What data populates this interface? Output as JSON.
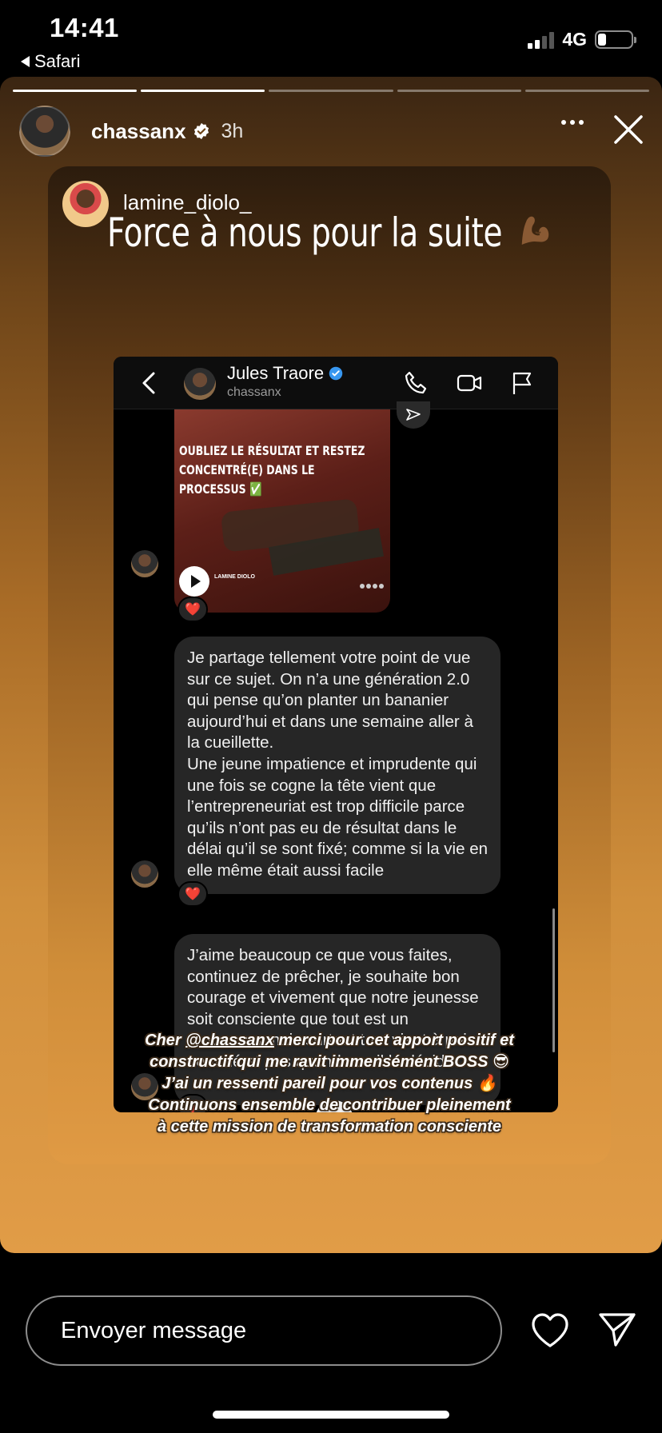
{
  "status_bar": {
    "time": "14:41",
    "back_app": "Safari",
    "network": "4G"
  },
  "story": {
    "progress_total": 5,
    "progress_done": 2,
    "username": "chassanx",
    "verified": true,
    "time_ago": "3h"
  },
  "repost": {
    "username": "lamine_diolo_",
    "title": "Force à nous pour la suite",
    "title_emoji": "flexed-biceps-icon"
  },
  "dm": {
    "contact_name": "Jules Traore",
    "contact_handle": "chassanx",
    "thumbnail_text": "Oubliez le résultat et restez concentré(e) dans le processus",
    "thumbnail_check": "✅",
    "thumbnail_brand": "LAMINE DIOLO",
    "message_1": "Je partage tellement votre point de vue sur ce sujet. On n’a une génération 2.0 qui pense qu’on planter un bananier aujourd’hui et dans une semaine aller à la cueillette.\nUne jeune impatience et imprudente qui une fois se cogne la tête vient que l’entrepreneuriat est trop difficile parce qu’ils n’ont pas eu de résultat dans le délai qu’il se sont fixé; comme si la vie en elle même était aussi facile",
    "message_2": "J’aime beaucoup ce que vous faites, continuez de prêcher, je souhaite bon courage et vivement que notre jeunesse soit consciente que tout est un processus mais surtout tout vient à point nommé et pas quand eux il le décide",
    "reaction": "❤️"
  },
  "caption": {
    "pre": "Cher ",
    "mention": "@chassanx",
    "line1_rest": " merci pour cet apport positif et",
    "line2": "constructif qui me ravit immensément BOSS 😎",
    "line3": "J’ai un ressenti pareil pour vos contenus 🔥",
    "line4": "Continuons ensemble de contribuer pleinement",
    "line5": "à cette mission de transformation consciente"
  },
  "reply": {
    "placeholder": "Envoyer message"
  },
  "colors": {
    "story_gradient_top": "#3a2512",
    "story_gradient_bottom": "#e19c47",
    "verified_blue": "#3897f0",
    "heart_red": "#e5342f"
  }
}
